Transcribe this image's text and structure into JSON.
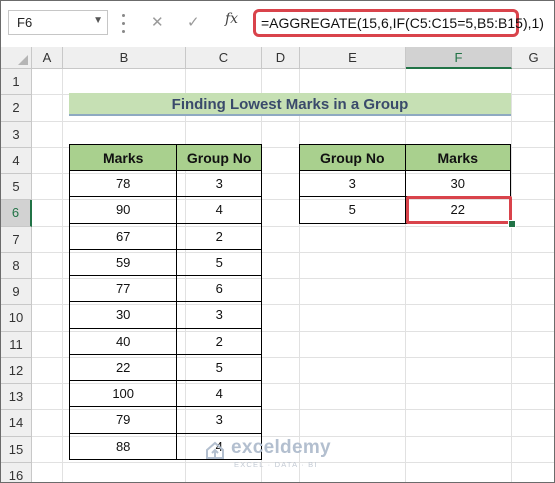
{
  "formula_bar": {
    "name_box": "F6",
    "name_box_caret": "▼",
    "cancel_glyph": "✕",
    "enter_glyph": "✓",
    "fx_label": "fx",
    "formula": "=AGGREGATE(15,6,IF(C5:C15=5,B5:B15),1)"
  },
  "columns": [
    "A",
    "B",
    "C",
    "D",
    "E",
    "F",
    "G"
  ],
  "selected_column": "F",
  "rows": [
    "1",
    "2",
    "3",
    "4",
    "5",
    "6",
    "7",
    "8",
    "9",
    "10",
    "11",
    "12",
    "13",
    "14",
    "15",
    "16"
  ],
  "selected_row": "6",
  "title": "Finding Lowest Marks in a Group",
  "data_table": {
    "headers": [
      "Marks",
      "Group No"
    ],
    "rows": [
      [
        "78",
        "3"
      ],
      [
        "90",
        "4"
      ],
      [
        "67",
        "2"
      ],
      [
        "59",
        "5"
      ],
      [
        "77",
        "6"
      ],
      [
        "30",
        "3"
      ],
      [
        "40",
        "2"
      ],
      [
        "22",
        "5"
      ],
      [
        "100",
        "4"
      ],
      [
        "79",
        "3"
      ],
      [
        "88",
        "4"
      ]
    ]
  },
  "result_table": {
    "headers": [
      "Group No",
      "Marks"
    ],
    "rows": [
      [
        "3",
        "30"
      ],
      [
        "5",
        "22"
      ]
    ]
  },
  "watermark": {
    "brand": "exceldemy",
    "tagline": "EXCEL · DATA · BI"
  },
  "colors": {
    "header_fill": "#a9d08e",
    "title_fill": "#c6e0b4",
    "highlight_border": "#d9434b",
    "excel_green": "#217346"
  }
}
